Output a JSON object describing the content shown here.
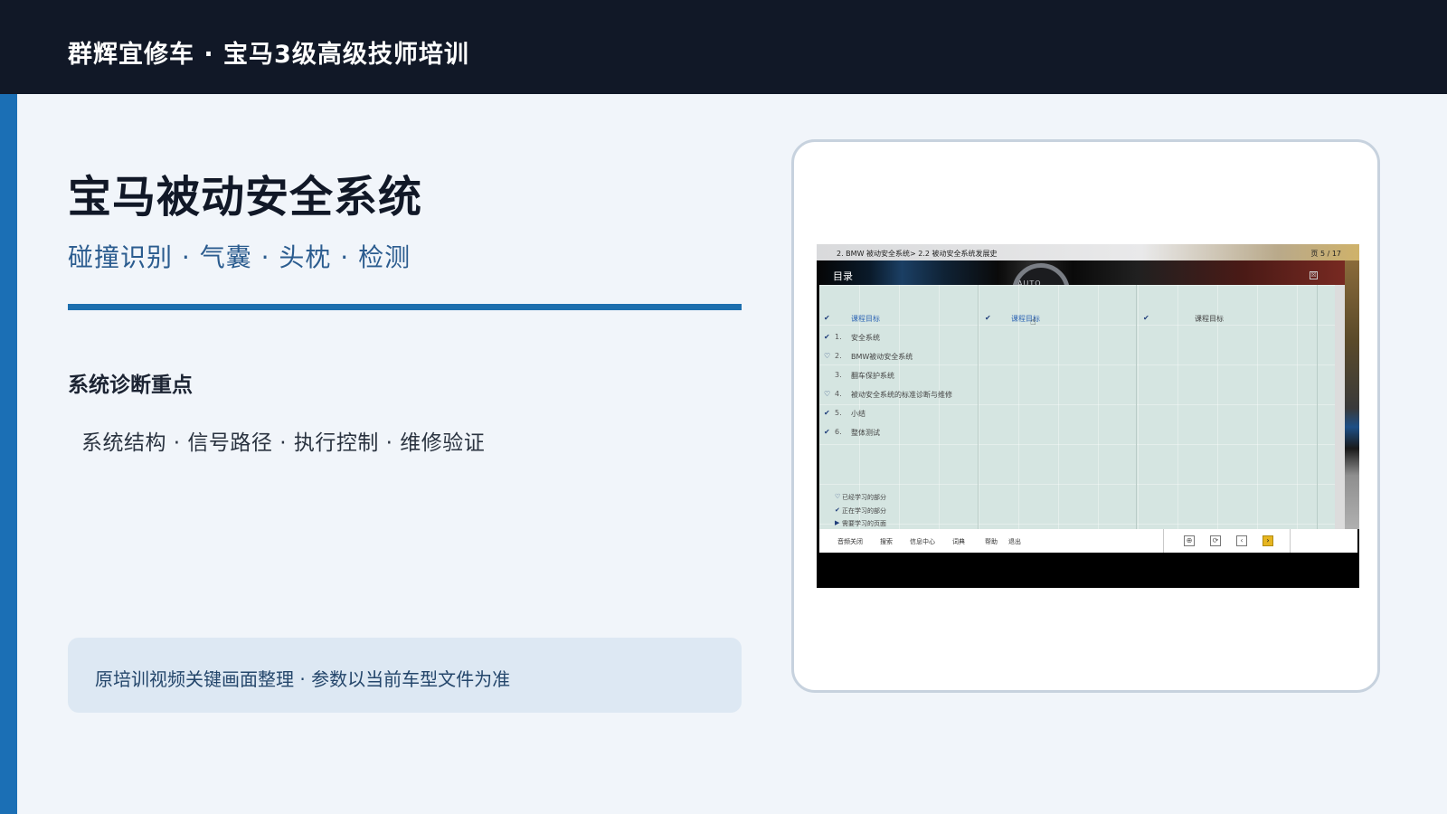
{
  "header": {
    "title": "群辉宜修车 · 宝马3级高级技师培训"
  },
  "slide": {
    "title": "宝马被动安全系统",
    "subtitle": "碰撞识别 · 气囊 · 头枕 · 检测",
    "section_title": "系统诊断重点",
    "key_points": "系统结构 · 信号路径 · 执行控制 · 维修验证",
    "note": "原培训视频关键画面整理 · 参数以当前车型文件为准"
  },
  "screenshot": {
    "path": "2. BMW 被动安全系统> 2.2 被动安全系统发展史",
    "page_label": "页  5 / 17",
    "header_label": "目录",
    "dial_label": "AUTO",
    "close_symbol": "☒",
    "check_symbol": "✔",
    "open_check_symbol": "♡",
    "arrow_symbol": "▶",
    "hand_symbol": "☝",
    "columns": [
      {
        "heading": "课程目标"
      },
      {
        "heading": "课程目标"
      },
      {
        "heading": "课程目标"
      }
    ],
    "menu_items": [
      {
        "number": "1.",
        "label": "安全系统"
      },
      {
        "number": "2.",
        "label": "BMW被动安全系统"
      },
      {
        "number": "3.",
        "label": "翻车保护系统"
      },
      {
        "number": "4.",
        "label": "被动安全系统的标准诊断与维修"
      },
      {
        "number": "5.",
        "label": "小结"
      },
      {
        "number": "6.",
        "label": "整体测试"
      }
    ],
    "legend": [
      {
        "label": "已经学习的部分"
      },
      {
        "label": "正在学习的部分"
      },
      {
        "label": "需要学习的页面"
      }
    ],
    "toolbar": {
      "buttons": [
        "音频关闭",
        "搜索",
        "信息中心",
        "词典",
        "帮助",
        "退出"
      ],
      "controls": [
        "⊕",
        "⟳",
        "‹",
        "›"
      ]
    }
  }
}
